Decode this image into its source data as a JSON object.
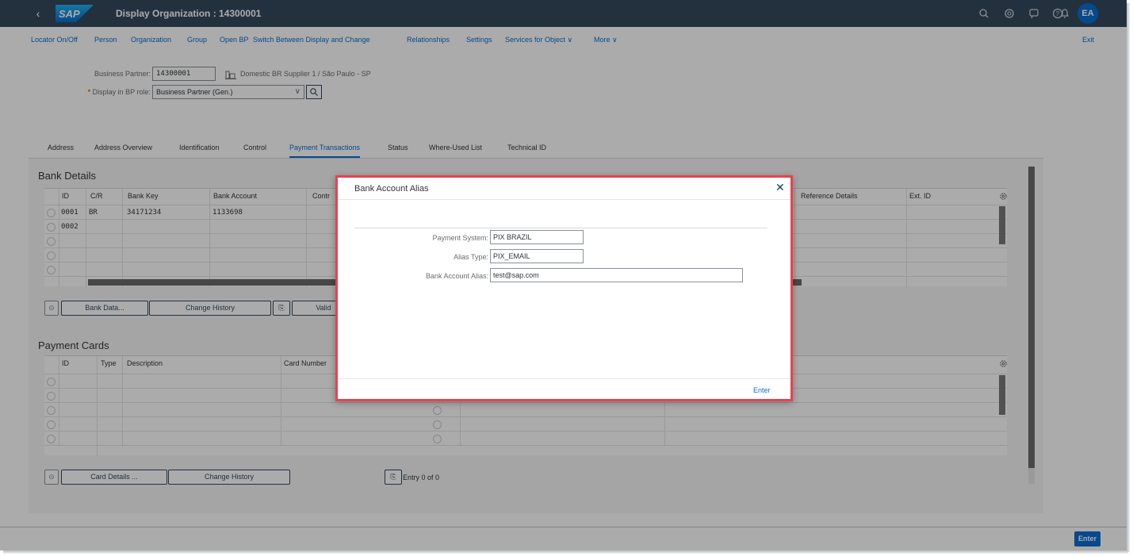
{
  "shell": {
    "logo_text": "SAP",
    "title": "Display Organization : 14300001",
    "avatar": "EA",
    "colors": {
      "shell_bg": "#354a5f",
      "accent": "#0a6ed1",
      "highlight_border": "#e8424d"
    },
    "icons": [
      "search-icon",
      "target-icon",
      "notes-icon",
      "help-icon",
      "bell-icon"
    ]
  },
  "menubar": {
    "items": [
      "Locator On/Off",
      "Person",
      "Organization",
      "Group",
      "Open BP",
      "Switch Between Display and Change",
      "Relationships",
      "Settings",
      "Services for Object",
      "More"
    ],
    "exit": "Exit"
  },
  "header": {
    "bp_label": "Business Partner:",
    "bp_value": "14300001",
    "bp_description": "Domestic BR Supplier 1 / São Paulo - SP",
    "role_label": "Display in BP role:",
    "role_value": "Business Partner (Gen.)",
    "required_marker": "*"
  },
  "tabs": [
    "Address",
    "Address Overview",
    "Identification",
    "Control",
    "Payment Transactions",
    "Status",
    "Where-Used List",
    "Technical ID"
  ],
  "active_tab": "Payment Transactions",
  "bank_details": {
    "title": "Bank Details",
    "columns": {
      "id": "ID",
      "cr": "C/R",
      "bank_key": "Bank Key",
      "bank_account": "Bank Account",
      "contr": "Contr",
      "reference_details": "Reference Details",
      "ext_id": "Ext. ID"
    },
    "rows": [
      {
        "id": "0001",
        "cr": "BR",
        "bank_key": "34171234",
        "bank_account": "1133698"
      },
      {
        "id": "0002",
        "cr": "",
        "bank_key": "",
        "bank_account": ""
      }
    ],
    "buttons": {
      "bank_data": "Bank Data...",
      "change_history": "Change History",
      "validity": "Valid"
    }
  },
  "payment_cards": {
    "title": "Payment Cards",
    "columns": {
      "id": "ID",
      "type": "Type",
      "description": "Description",
      "card_number": "Card Number"
    },
    "buttons": {
      "card_details": "Card Details ...",
      "change_history": "Change History"
    },
    "entry_text": "Entry 0 of 0"
  },
  "dialog": {
    "title": "Bank Account Alias",
    "fields": {
      "payment_system_label": "Payment System:",
      "payment_system_value": "PIX BRAZIL",
      "alias_type_label": "Alias Type:",
      "alias_type_value": "PIX_EMAIL",
      "alias_label": "Bank Account Alias:",
      "alias_value": "test@sap.com"
    },
    "enter": "Enter"
  },
  "footer": {
    "enter": "Enter"
  }
}
